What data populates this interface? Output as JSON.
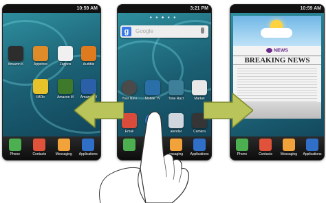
{
  "center": {
    "status_time": "3:21 PM",
    "search_label": "Google",
    "apps": [
      {
        "label": "Your Navi",
        "color": "#4a4a4a"
      },
      {
        "label": "Mobile TV",
        "color": "#2a6fa8"
      },
      {
        "label": "Tone Razr",
        "color": "#3e7f9a"
      },
      {
        "label": "Market",
        "color": "#e8e8e8"
      },
      {
        "label": "Email",
        "color": "#d94b3a"
      },
      {
        "label": "Br",
        "color": "#2f79c8"
      },
      {
        "label": "alendar",
        "color": "#cfd6dd"
      },
      {
        "label": "Camera",
        "color": "#353535"
      }
    ],
    "dock": [
      {
        "label": "",
        "color": "#4caf50"
      },
      {
        "label": "",
        "color": "#e0533a"
      },
      {
        "label": "essaging",
        "color": "#f2a23a"
      },
      {
        "label": "Applications",
        "color": "#2f6fc8"
      }
    ]
  },
  "left": {
    "status_time": "10:59 AM",
    "apps": [
      {
        "label": "Amazon K",
        "color": "#2d2d2d"
      },
      {
        "label": "Appstore",
        "color": "#e08b2a"
      },
      {
        "label": "Zappos",
        "color": "#f0f0f0"
      },
      {
        "label": "Audible",
        "color": "#e07a1f"
      },
      {
        "label": "IMDb",
        "color": "#e8c22a"
      },
      {
        "label": "Amazon M",
        "color": "#3f7a2a"
      },
      {
        "label": "Amazon W",
        "color": "#2b5fa8"
      }
    ],
    "dock": [
      {
        "label": "Phone",
        "color": "#4caf50"
      },
      {
        "label": "Contacts",
        "color": "#e0533a"
      },
      {
        "label": "Messaging",
        "color": "#f2a23a"
      },
      {
        "label": "Applications",
        "color": "#2f6fc8"
      }
    ]
  },
  "right": {
    "status_time": "10:59 AM",
    "news_brand": "NEWS",
    "headline": "BREAKING NEWS",
    "dock": [
      {
        "label": "Phone",
        "color": "#4caf50"
      },
      {
        "label": "Contacts",
        "color": "#e0533a"
      },
      {
        "label": "Messaging",
        "color": "#f2a23a"
      },
      {
        "label": "Applications",
        "color": "#2f6fc8"
      }
    ]
  },
  "colors": {
    "arrow": "#b9c45a",
    "arrow_edge": "#7f8a2e"
  }
}
